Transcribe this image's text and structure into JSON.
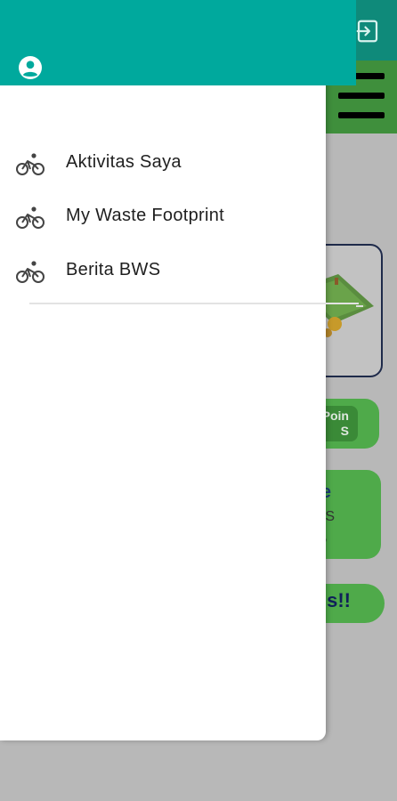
{
  "colors": {
    "drawer_header": "#00a99d",
    "app_topbar": "#0f8a7a",
    "app_green": "#4faa4a",
    "scrim": "#b8b8b8"
  },
  "drawer": {
    "header": {
      "icon": "account-circle-icon"
    },
    "items": [
      {
        "icon": "bicycle-icon",
        "label": "Aktivitas Saya"
      },
      {
        "icon": "bicycle-icon",
        "label": "My Waste Footprint"
      },
      {
        "icon": "bicycle-icon",
        "label": "Berita BWS"
      }
    ]
  },
  "background": {
    "topbar_icon": "logout-icon",
    "menu_icon": "hamburger-menu-icon",
    "poin_text": "Poin\nS",
    "card_title": "e",
    "card_line1": "S",
    "card_line2": ",",
    "promo_text": "s!!"
  }
}
